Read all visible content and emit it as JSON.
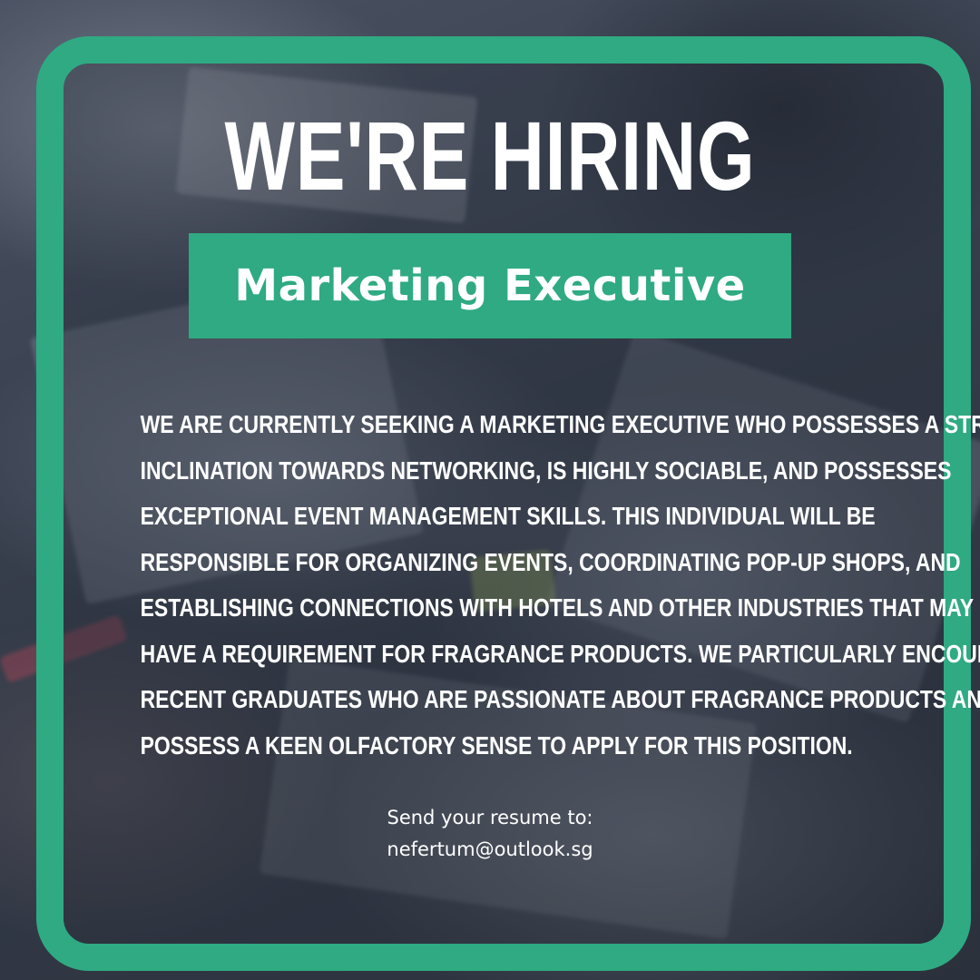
{
  "colors": {
    "accent": "#2faa82",
    "text": "#ffffff"
  },
  "headline": "WE'RE HIRING",
  "role": "Marketing Executive",
  "description_lines": [
    "We are currently seeking a Marketing Executive who possesses a strong",
    "inclination towards networking, is highly sociable, and possesses",
    "exceptional event management skills. This individual will be",
    "responsible for organizing events, coordinating pop-up shops, and",
    "establishing connections with hotels and other industries that may",
    "have a requirement for fragrance products. We particularly encourage",
    "recent graduates who are passionate about fragrance products and",
    "possess a keen olfactory sense to apply for this position."
  ],
  "contact": {
    "label": "Send your resume to:",
    "email": "nefertum@outlook.sg"
  }
}
